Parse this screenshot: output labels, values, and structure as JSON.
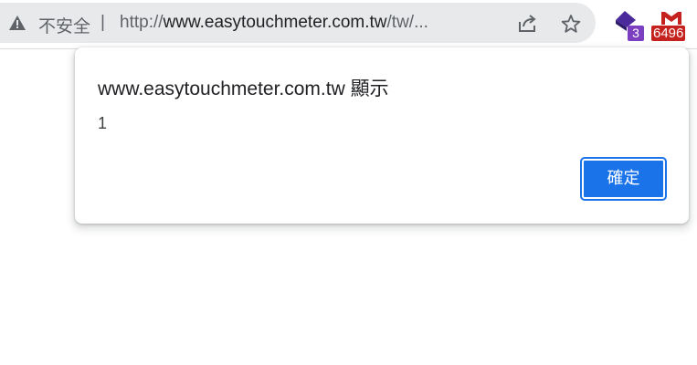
{
  "toolbar": {
    "not_secure_label": "不安全",
    "separator": "|",
    "url_scheme": "http://",
    "url_host": "www.easytouchmeter.com.tw",
    "url_path": "/tw/...",
    "share_icon": "share-icon",
    "bookmark_icon": "star-icon",
    "warning_icon": "warning-triangle-icon"
  },
  "extensions": {
    "ext1": {
      "icon": "purple-shape-icon",
      "badge": "3",
      "badge_color": "#7b3fbf"
    },
    "ext2": {
      "icon": "gmail-icon",
      "badge": "6496",
      "badge_color": "#c5221f"
    }
  },
  "dialog": {
    "title": "www.easytouchmeter.com.tw 顯示",
    "message": "1",
    "ok_label": "確定",
    "accent_color": "#1a73e8"
  }
}
